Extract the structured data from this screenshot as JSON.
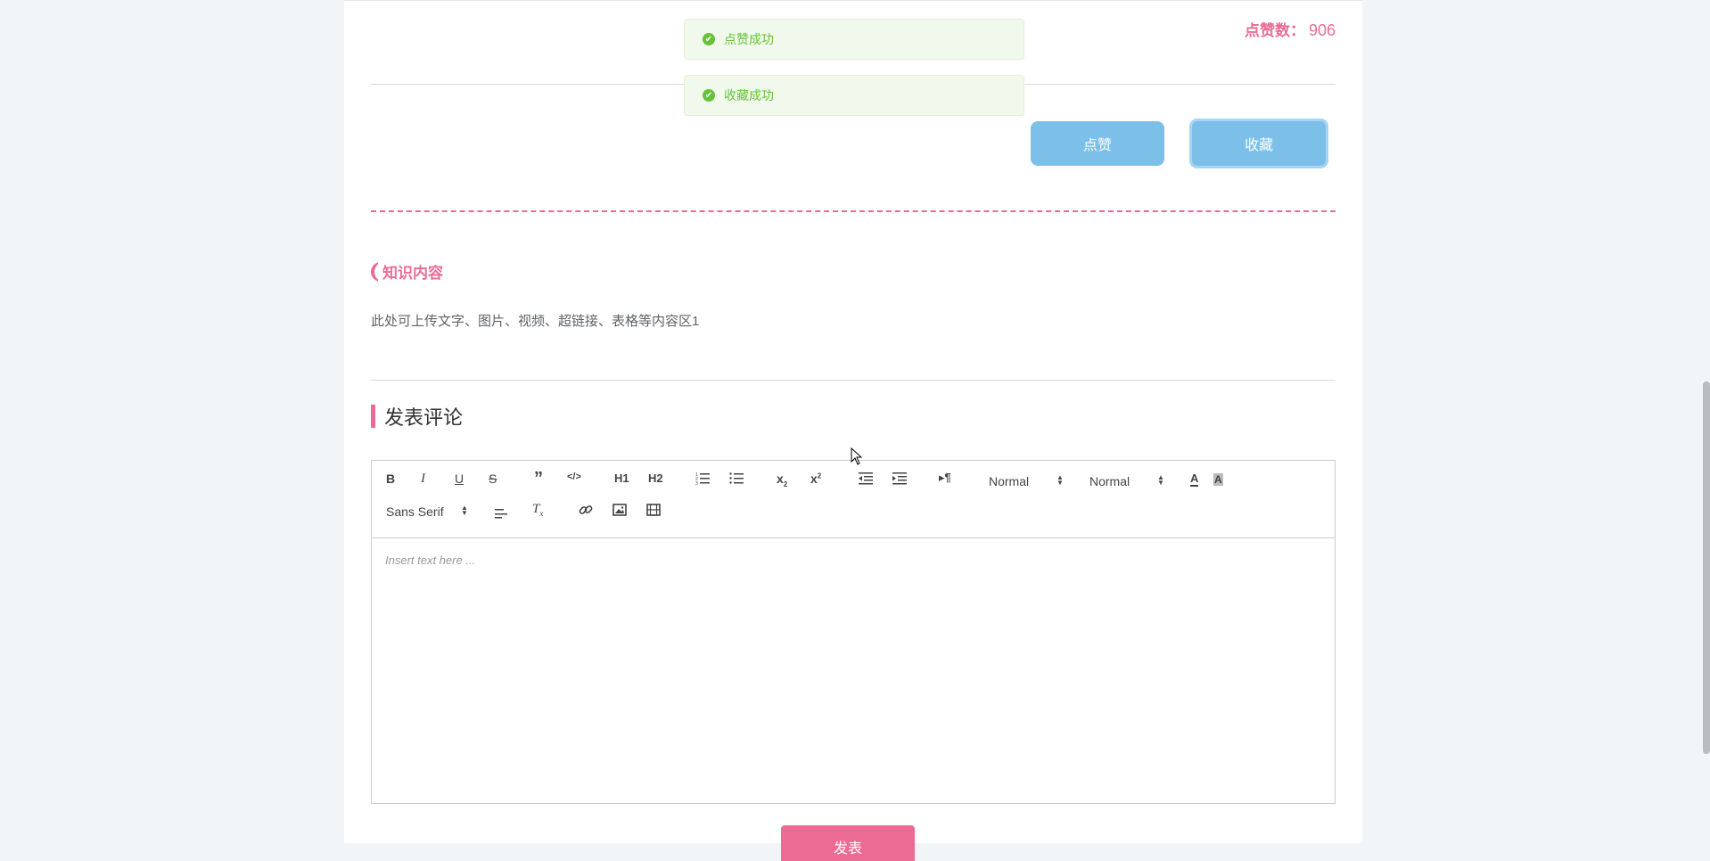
{
  "stats": {
    "like_label": "点赞数：",
    "like_count": "906"
  },
  "actions": {
    "like": "点赞",
    "collect": "收藏"
  },
  "toasts": [
    {
      "text": "点赞成功"
    },
    {
      "text": "收藏成功"
    }
  ],
  "knowledge": {
    "title": "知识内容",
    "body": "此处可上传文字、图片、视频、超链接、表格等内容区1"
  },
  "comment": {
    "title": "发表评论",
    "toolbar": {
      "header1": "H1",
      "header2": "H2",
      "size_select": "Normal",
      "header_select": "Normal",
      "font_select": "Sans Serif"
    },
    "placeholder": "Insert text here ...",
    "submit": "发表"
  },
  "colors": {
    "accent": "#ec6b95",
    "button": "#7cc0ea",
    "success": "#67c23a"
  }
}
